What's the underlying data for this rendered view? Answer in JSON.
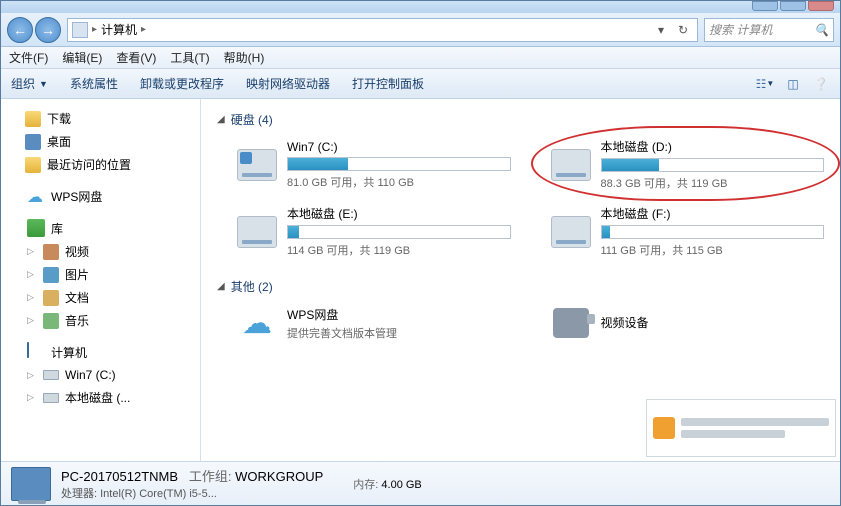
{
  "titlebar": {
    "min": "—",
    "max": "☐",
    "close": "×"
  },
  "addressbar": {
    "back": "←",
    "forward": "→",
    "crumb1": "计算机",
    "refresh": "↻",
    "search_placeholder": "搜索 计算机"
  },
  "menubar": {
    "file": "文件(F)",
    "edit": "编辑(E)",
    "view": "查看(V)",
    "tools": "工具(T)",
    "help": "帮助(H)"
  },
  "toolbar": {
    "organize": "组织",
    "system_props": "系统属性",
    "uninstall": "卸载或更改程序",
    "map_drive": "映射网络驱动器",
    "control_panel": "打开控制面板"
  },
  "sidebar": {
    "downloads": "下载",
    "desktop": "桌面",
    "recent": "最近访问的位置",
    "wps": "WPS网盘",
    "libraries": "库",
    "video": "视频",
    "pictures": "图片",
    "documents": "文档",
    "music": "音乐",
    "computer": "计算机",
    "drive_c": "Win7 (C:)",
    "drive_d_tree": "本地磁盘 (..."
  },
  "content": {
    "section_hdd": "硬盘 (4)",
    "section_other": "其他 (2)",
    "drives": [
      {
        "name": "Win7 (C:)",
        "status": "81.0 GB 可用，共 110 GB",
        "fill": 27,
        "win": true
      },
      {
        "name": "本地磁盘 (D:)",
        "status": "88.3 GB 可用，共 119 GB",
        "fill": 26,
        "highlight": true
      },
      {
        "name": "本地磁盘 (E:)",
        "status": "114 GB 可用，共 119 GB",
        "fill": 5
      },
      {
        "name": "本地磁盘 (F:)",
        "status": "111 GB 可用，共 115 GB",
        "fill": 4
      }
    ],
    "others": {
      "wps_name": "WPS网盘",
      "wps_desc": "提供完善文档版本管理",
      "video_device": "视频设备"
    }
  },
  "details": {
    "name": "PC-20170512TNMB",
    "workgroup_label": "工作组:",
    "workgroup_value": "WORKGROUP",
    "cpu_label": "处理器:",
    "cpu_value": "Intel(R) Core(TM) i5-5...",
    "mem_label": "内存:",
    "mem_value": "4.00 GB"
  }
}
